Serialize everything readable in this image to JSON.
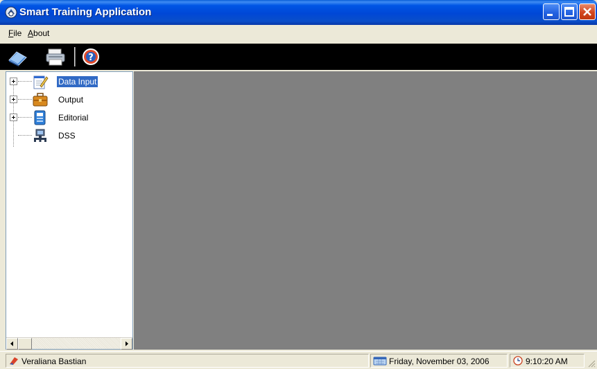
{
  "window": {
    "title": "Smart Training Application",
    "title_color": "#0055e5",
    "controls": [
      "minimize-icon",
      "maximize-icon",
      "close-icon"
    ]
  },
  "menu": {
    "file": {
      "accel": "F",
      "rest": "ile"
    },
    "about": {
      "accel": "A",
      "rest": "bout"
    }
  },
  "toolbar": {
    "buttons": [
      {
        "name": "open-book-icon"
      },
      {
        "name": "printer-icon"
      },
      {
        "name": "help-icon"
      }
    ]
  },
  "tree": {
    "nodes": [
      {
        "label": "Data Input",
        "icon": "notepad-pen-icon",
        "expandable": true,
        "selected": true
      },
      {
        "label": "Output",
        "icon": "briefcase-icon",
        "expandable": true,
        "selected": false
      },
      {
        "label": "Editorial",
        "icon": "document-book-icon",
        "expandable": true,
        "selected": false
      },
      {
        "label": "DSS",
        "icon": "network-computer-icon",
        "expandable": false,
        "selected": false
      }
    ]
  },
  "content": {
    "background": "#808080"
  },
  "status": {
    "user": "Veraliana Bastian",
    "date": "Friday, November 03, 2006",
    "time": "9:10:20 AM"
  }
}
